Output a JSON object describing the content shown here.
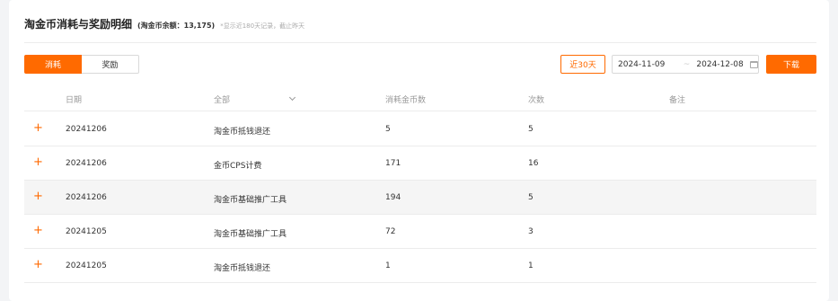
{
  "header": {
    "title": "淘金币消耗与奖励明细",
    "balance": "(淘金币余额：13,175)",
    "note": "*显示近180天记录，截止昨天"
  },
  "tabs": [
    "消耗",
    "奖励"
  ],
  "filters": {
    "recent_label": "近30天",
    "date_start": "2024-11-09",
    "date_end": "2024-12-08",
    "download_label": "下载"
  },
  "table": {
    "headers": [
      "日期",
      "全部",
      "消耗金币数",
      "次数",
      "备注"
    ],
    "rows": [
      {
        "date": "20241206",
        "type": "淘金币抵钱退还",
        "coins": "5",
        "times": "5",
        "remark": ""
      },
      {
        "date": "20241206",
        "type": "金币CPS计费",
        "coins": "171",
        "times": "16",
        "remark": ""
      },
      {
        "date": "20241206",
        "type": "淘金币基础推广工具",
        "coins": "194",
        "times": "5",
        "remark": ""
      },
      {
        "date": "20241205",
        "type": "淘金币基础推广工具",
        "coins": "72",
        "times": "3",
        "remark": ""
      },
      {
        "date": "20241205",
        "type": "淘金币抵钱退还",
        "coins": "1",
        "times": "1",
        "remark": ""
      }
    ]
  },
  "colors": {
    "accent": "#ff6a00",
    "row_highlight": "#f5f5f5"
  },
  "icons": {
    "expand": "plus-icon",
    "calendar": "calendar-icon",
    "dropdown": "chevron-down-icon"
  }
}
